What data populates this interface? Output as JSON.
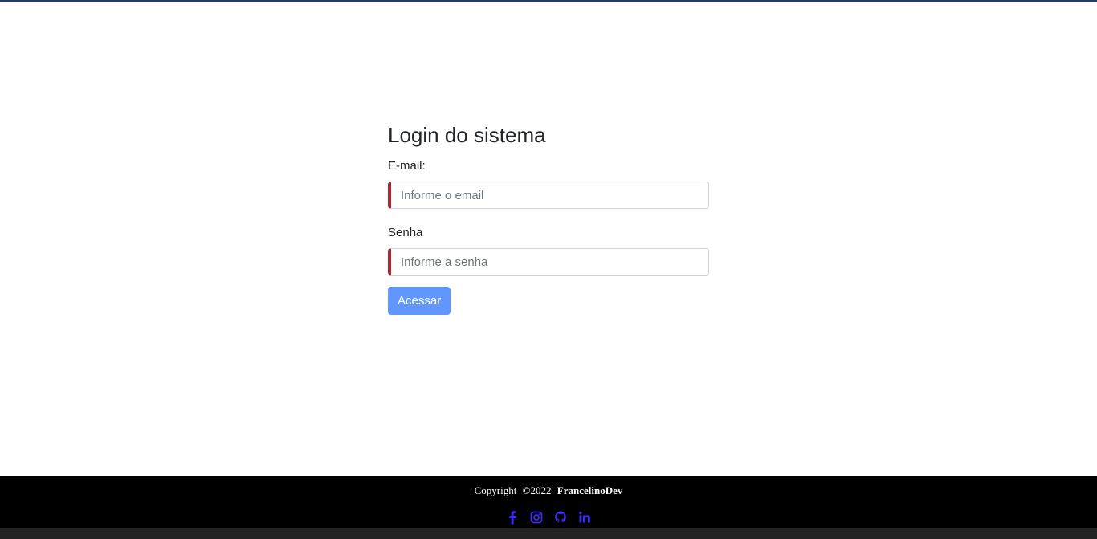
{
  "login": {
    "title": "Login do sistema",
    "email_label": "E-mail:",
    "email_placeholder": "Informe o email",
    "email_value": "",
    "password_label": "Senha",
    "password_placeholder": "Informe a senha",
    "password_value": "",
    "submit_label": "Acessar"
  },
  "footer": {
    "copyright_word": "Copyright",
    "copyright_year": "©2022",
    "brand": "FrancelinoDev",
    "social_icons": [
      "facebook-icon",
      "instagram-icon",
      "github-icon",
      "linkedin-icon"
    ]
  },
  "colors": {
    "top_bar": "#263a5e",
    "input_accent": "#a8262e",
    "button": "#6196fd",
    "social_icon": "#3b2cf5",
    "footer_bg": "#000000"
  }
}
